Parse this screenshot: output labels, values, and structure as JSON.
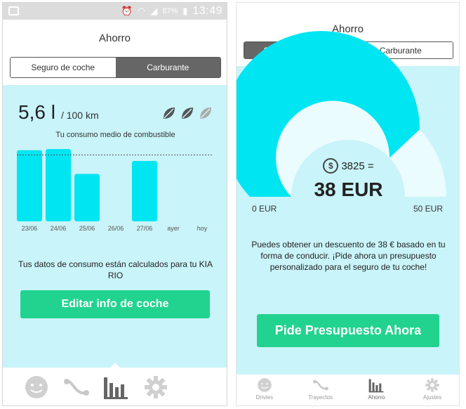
{
  "colors": {
    "panel": "#c9f4f9",
    "bar": "#00e5f2",
    "gauge_track": "#eafcfd",
    "green_button": "#22d38f",
    "active_segment": "#666666",
    "nav_icon": "#bdbdbd",
    "nav_icon_active": "#666666"
  },
  "status_bar": {
    "battery": "87%",
    "time": "13:49",
    "icons": [
      "image-icon",
      "alarm-icon",
      "wifi-icon",
      "signal-icon",
      "battery-icon"
    ]
  },
  "left": {
    "title": "Ahorro",
    "segments": [
      {
        "label": "Seguro de coche",
        "active": false
      },
      {
        "label": "Carburante",
        "active": true
      }
    ],
    "consumption_value": "5,6 l",
    "consumption_unit": "/ 100 km",
    "leaf_ratings": {
      "filled": 2,
      "total": 3
    },
    "chart_caption": "Tu consumo medio de combustible",
    "info_text": "Tus datos de consumo están calculados para tu KIA RIO",
    "button_label": "Editar info de coche",
    "nav_icons": [
      "face-icon",
      "route-icon",
      "bar-chart-icon",
      "gear-icon"
    ],
    "active_nav": 2
  },
  "chart_data": {
    "type": "bar",
    "title": "Tu consumo medio de combustible",
    "categories": [
      "23/06",
      "24/06",
      "25/06",
      "26/06",
      "27/06",
      "ayer",
      "hoy"
    ],
    "values": [
      6.0,
      6.1,
      4.0,
      null,
      5.1,
      null,
      null
    ],
    "reference_line": 5.6,
    "ylim": [
      0,
      6.4
    ],
    "xlabel": "",
    "ylabel": "",
    "grid": false
  },
  "right": {
    "title": "Ahorro",
    "segments": [
      {
        "label": "Seguro del coche",
        "active": true
      },
      {
        "label": "Carburante",
        "active": false
      }
    ],
    "gauge": {
      "min": 0,
      "max": 50,
      "value": 38,
      "min_label": "0 EUR",
      "max_label": "50 EUR"
    },
    "points": "3825 =",
    "amount": "38 EUR",
    "coin_symbol": "$",
    "discount_text": "Puedes obtener un descuento de 38 € basado en tu forma de conducir. ¡Pide ahora un presupuesto personalizado para el seguro de tu coche!",
    "button_label": "Pide Presupuesto Ahora",
    "nav": [
      {
        "label": "Drivies",
        "icon": "face-icon"
      },
      {
        "label": "Trayectos",
        "icon": "route-icon"
      },
      {
        "label": "Ahorro",
        "icon": "bar-chart-icon",
        "active": true
      },
      {
        "label": "Ajustes",
        "icon": "gear-icon"
      }
    ]
  }
}
